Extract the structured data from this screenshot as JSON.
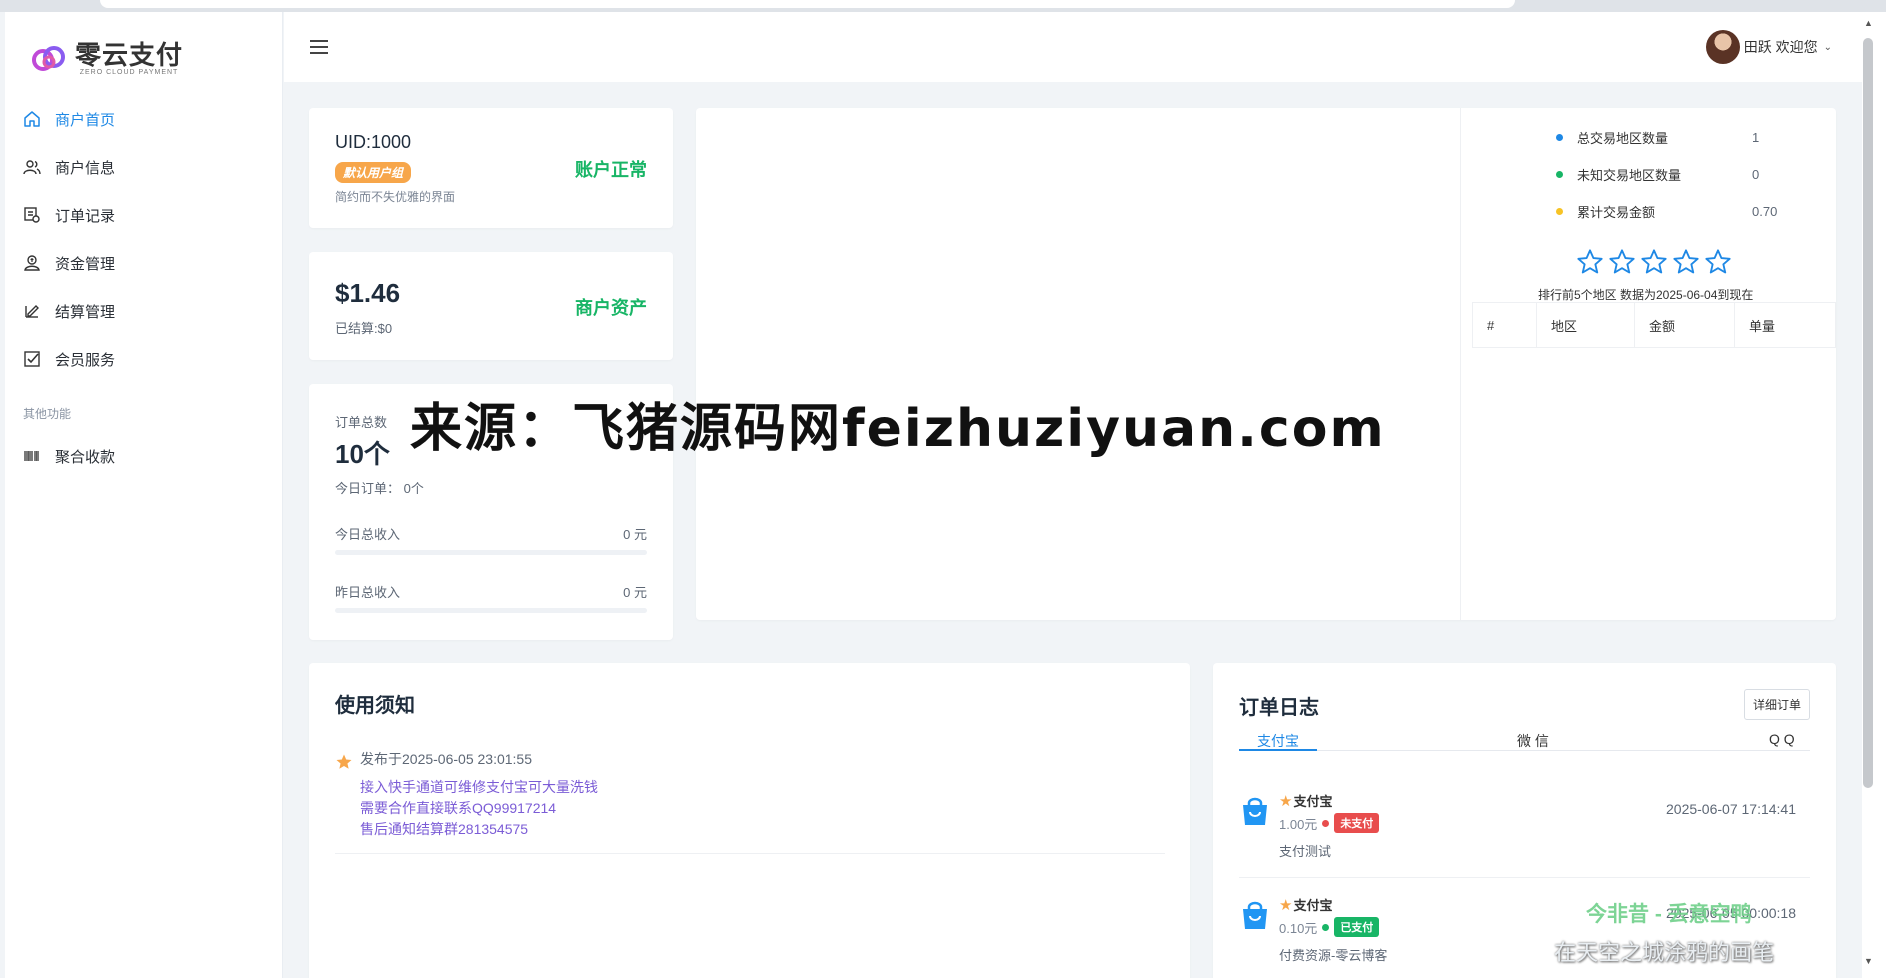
{
  "app": {
    "brand_name": "零云支付",
    "brand_sub": "ZERO CLOUD PAYMENT"
  },
  "sidebar": {
    "items": [
      {
        "label": "商户首页",
        "icon": "home-icon",
        "active": true
      },
      {
        "label": "商户信息",
        "icon": "users-icon"
      },
      {
        "label": "订单记录",
        "icon": "order-list-icon"
      },
      {
        "label": "资金管理",
        "icon": "funds-icon"
      },
      {
        "label": "结算管理",
        "icon": "edit-icon"
      },
      {
        "label": "会员服务",
        "icon": "checkbox-icon"
      }
    ],
    "group_label": "其他功能",
    "extra_items": [
      {
        "label": "聚合收款",
        "icon": "barcode-icon"
      }
    ]
  },
  "header": {
    "user_greeting": "田跃 欢迎您"
  },
  "account_card": {
    "uid": "UID:1000",
    "group_badge": "默认用户组",
    "slogan": "简约而不失优雅的界面",
    "status": "账户正常"
  },
  "asset_card": {
    "balance": "$1.46",
    "settled": "已结算:$0",
    "label": "商户资产"
  },
  "orders_card": {
    "total_label": "订单总数",
    "total_value": "10个",
    "today_orders": "今日订单：  0个",
    "today_income_label": "今日总收入",
    "today_income_value": "0 元",
    "today_income_fraction": 0,
    "yesterday_income_label": "昨日总收入",
    "yesterday_income_value": "0 元",
    "yesterday_income_fraction": 0
  },
  "region_stats": {
    "items": [
      {
        "label": "总交易地区数量",
        "value": "1",
        "color": "#1e88e5"
      },
      {
        "label": "未知交易地区数量",
        "value": "0",
        "color": "#18b566"
      },
      {
        "label": "累计交易金额",
        "value": "0.70",
        "color": "#f7c325"
      }
    ],
    "stars_filled": 0,
    "stars_total": 5,
    "rank_note": "排行前5个地区  数据为2025-06-04到现在",
    "table_headers": [
      "#",
      "地区",
      "金额",
      "单量"
    ]
  },
  "notice": {
    "title": "使用须知",
    "date": "发布于2025-06-05 23:01:55",
    "lines": [
      "接入快手通道可维修支付宝可大量洗钱",
      "需要合作直接联系QQ99917214",
      "售后通知结算群281354575"
    ]
  },
  "order_log": {
    "title": "订单日志",
    "detail_button": "详细订单",
    "tabs": [
      "支付宝",
      "微 信",
      "Q Q"
    ],
    "orders": [
      {
        "name": "支付宝",
        "amount": "1.00元",
        "status": "未支付",
        "status_color": "#e84d4d",
        "time": "2025-06-07 17:14:41",
        "desc": "支付测试"
      },
      {
        "name": "支付宝",
        "amount": "0.10元",
        "status": "已支付",
        "status_color": "#18b566",
        "time": "2025-06-05 00:00:18",
        "desc": "付费资源-零云博客"
      }
    ]
  },
  "watermarks": {
    "main": "来源：飞猪源码网feizhuziyuan.com",
    "corner_top": "今非昔 - 丢意空鸭",
    "corner_bottom": "在天空之城涂鸦的画笔"
  }
}
